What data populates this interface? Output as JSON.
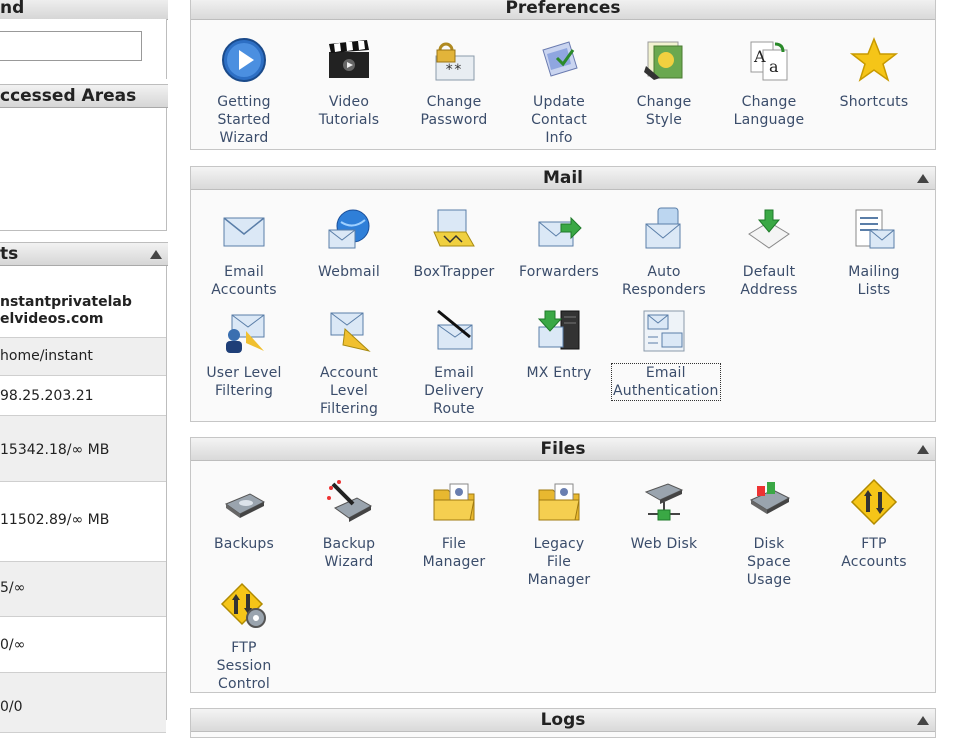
{
  "left": {
    "find": {
      "header_partial": "nd",
      "input_value": ""
    },
    "recent": {
      "header_partial": "ccessed Areas"
    },
    "stats": {
      "header_partial": "ts",
      "rows": [
        {
          "line1": "nstantprivatelab",
          "line2": "elvideos.com"
        },
        {
          "line1": "home/instant"
        },
        {
          "line1": "98.25.203.21"
        },
        {
          "line1": "15342.18/∞ MB"
        },
        {
          "line1": "11502.89/∞ MB"
        },
        {
          "line1": "5/∞"
        },
        {
          "line1": "0/∞"
        },
        {
          "line1": "0/0"
        }
      ]
    }
  },
  "sections": {
    "preferences": {
      "title": "Preferences",
      "items": [
        {
          "label": "Getting\nStarted\nWizard",
          "icon": "play-icon"
        },
        {
          "label": "Video\nTutorials",
          "icon": "clapperboard-icon"
        },
        {
          "label": "Change\nPassword",
          "icon": "lock-password-icon"
        },
        {
          "label": "Update\nContact\nInfo",
          "icon": "contact-info-icon"
        },
        {
          "label": "Change\nStyle",
          "icon": "style-icon"
        },
        {
          "label": "Change\nLanguage",
          "icon": "language-icon"
        },
        {
          "label": "Shortcuts",
          "icon": "star-icon"
        }
      ]
    },
    "mail": {
      "title": "Mail",
      "items": [
        {
          "label": "Email\nAccounts",
          "icon": "envelope-icon"
        },
        {
          "label": "Webmail",
          "icon": "globe-envelope-icon"
        },
        {
          "label": "BoxTrapper",
          "icon": "boxtrapper-icon"
        },
        {
          "label": "Forwarders",
          "icon": "forward-envelope-icon"
        },
        {
          "label": "Auto\nResponders",
          "icon": "auto-responder-icon"
        },
        {
          "label": "Default\nAddress",
          "icon": "default-address-icon"
        },
        {
          "label": "Mailing\nLists",
          "icon": "mailing-list-icon"
        },
        {
          "label": "User Level\nFiltering",
          "icon": "user-filter-icon"
        },
        {
          "label": "Account\nLevel\nFiltering",
          "icon": "account-filter-icon"
        },
        {
          "label": "Email\nDelivery\nRoute",
          "icon": "delivery-route-icon"
        },
        {
          "label": "MX Entry",
          "icon": "mx-server-icon"
        },
        {
          "label": "Email\nAuthentication",
          "icon": "email-auth-icon"
        }
      ]
    },
    "files": {
      "title": "Files",
      "items": [
        {
          "label": "Backups",
          "icon": "backup-disk-icon"
        },
        {
          "label": "Backup\nWizard",
          "icon": "backup-wizard-icon"
        },
        {
          "label": "File\nManager",
          "icon": "folder-icon"
        },
        {
          "label": "Legacy\nFile\nManager",
          "icon": "legacy-folder-icon"
        },
        {
          "label": "Web Disk",
          "icon": "web-disk-icon"
        },
        {
          "label": "Disk\nSpace\nUsage",
          "icon": "disk-usage-icon"
        },
        {
          "label": "FTP\nAccounts",
          "icon": "ftp-icon"
        },
        {
          "label": "FTP\nSession\nControl",
          "icon": "ftp-session-icon"
        }
      ]
    },
    "logs": {
      "title": "Logs"
    }
  },
  "colors": {
    "label": "#3b4d6b",
    "header_gradient_top": "#f4f4f4",
    "header_gradient_bottom": "#d9d9d9"
  }
}
